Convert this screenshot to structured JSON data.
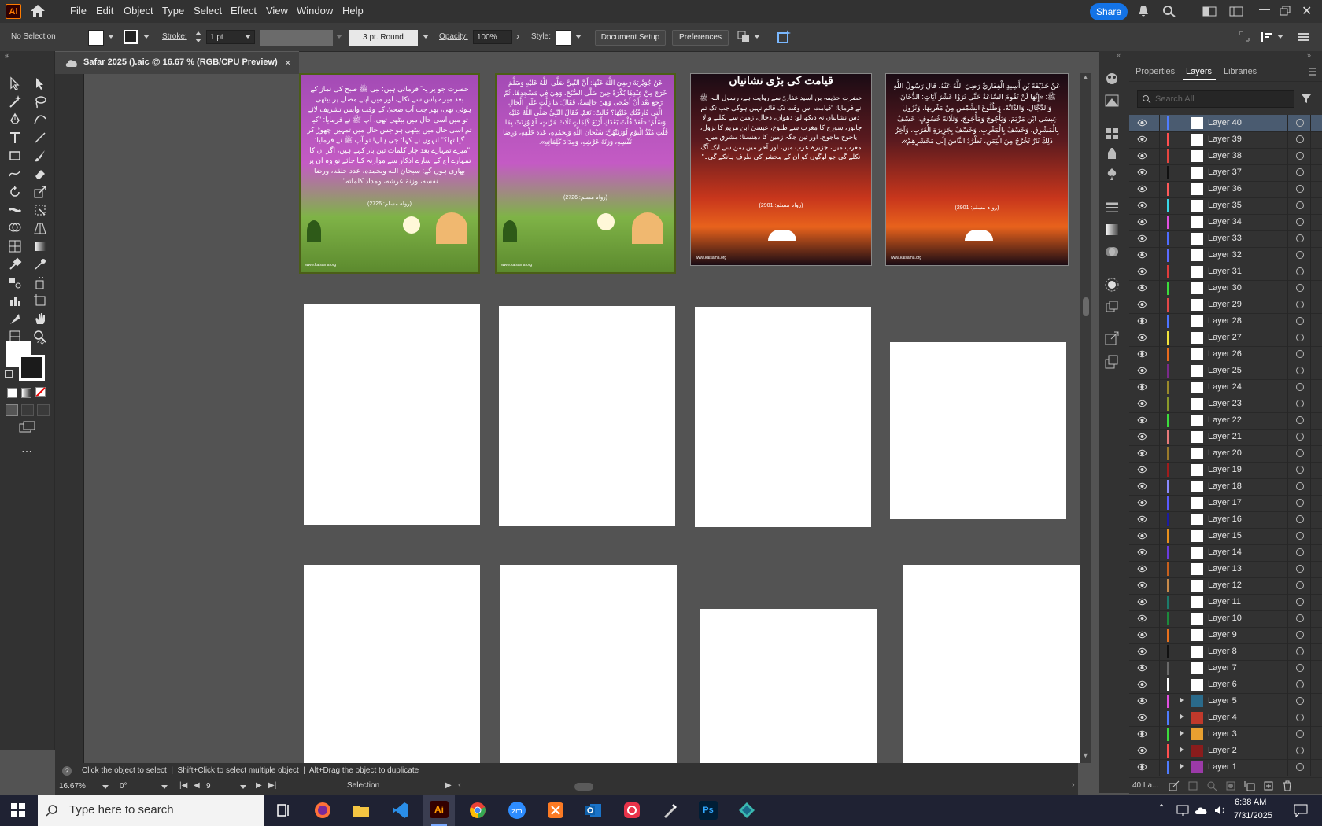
{
  "app": {
    "logo": "Ai",
    "share_label": "Share"
  },
  "menu": [
    "File",
    "Edit",
    "Object",
    "Type",
    "Select",
    "Effect",
    "View",
    "Window",
    "Help"
  ],
  "control_bar": {
    "selection_label": "No Selection",
    "stroke_label": "Stroke:",
    "stroke_value": "1 pt",
    "brush_value": "3 pt. Round",
    "opacity_label": "Opacity:",
    "opacity_value": "100%",
    "style_label": "Style:",
    "document_setup": "Document Setup",
    "preferences": "Preferences"
  },
  "document_tab": {
    "title": "Safar 2025 ().aic @ 16.67 % (RGB/CPU Preview)",
    "close": "×"
  },
  "artwork": {
    "poster1_text": "حضرت جو یر یہ ؓ فرماتی ہیں: نبی ﷺ صبح کی نماز کے بعد میرے پاس سے نکلے، اور میں اپنے مصلے پر بیٹھی ہوئی تھی، پھر جب آپ ضحیٰ کے وقت واپس تشریف لائے تو میں اسی حال میں بیٹھی تھی، آپ ﷺ نے فرمایا: \"کیا تم اسی حال میں بیٹھی ہو جس حال میں تمہیں چھوڑ کر گیا تھا؟\" انہوں نے کہا: جی ہاں! تو آپ ﷺ نے فرمایا: \"میرے تمہارے بعد چار کلمات تین بار کہے ہیں، اگر ان کا تمہارے آج کے سارے اذکار سے موازنہ کیا جائے تو وہ ان پر بھاری ہوں گے: سبحان الله وبحمده، عدد خلقه، ورضا نفسه، وزنة عرشه، ومداد كلماته\".",
    "poster1_ref": "(رواہ مسلم: 2726)",
    "poster2_text": "عَنْ جُوَيْرِيَةَ رَضِيَ اللَّهُ عَنْهَا: أَنَّ النَّبِيَّ صَلَّى اللَّهُ عَلَيْهِ وَسَلَّمَ خَرَجَ مِنْ عِنْدِهَا بُكْرَةً حِينَ صَلَّى الصُّبْحَ، وَهِيَ فِي مَسْجِدِهَا، ثُمَّ رَجَعَ بَعْدَ أَنْ أَضْحَى وَهِيَ جَالِسَةٌ، فَقَالَ: مَا زِلْتِ عَلَى الْحَالِ الَّتِي فَارَقْتُكِ عَلَيْهَا؟ قَالَتْ: نَعَمْ. فَقَالَ النَّبِيُّ صَلَّى اللَّهُ عَلَيْهِ وَسَلَّمَ: «لَقَدْ قُلْتُ بَعْدَكِ أَرْبَعَ كَلِمَاتٍ ثَلَاثَ مَرَّاتٍ، لَوْ وُزِنَتْ بِمَا قُلْتِ مُنْذُ الْيَوْمِ لَوَزَنَتْهُنَّ: سُبْحَانَ اللَّهِ وَبِحَمْدِهِ، عَدَدَ خَلْقِهِ، وَرِضَا نَفْسِهِ، وَزِنَةَ عَرْشِهِ، وَمِدَادَ كَلِمَاتِهِ».",
    "poster2_ref": "(رواہ مسلم: 2726)",
    "poster3_title": "قیامت کی بڑی نشانیاں",
    "poster3_text": "حضرت حذیفہ بن اَسید غفاریؓ سے روایت ہے، رسول اللہ ﷺ نے فرمایا: \"قیامت اس وقت تک قائم نہیں ہوگی جب تک تم دس نشانیاں نہ دیکھ لو: دھواں، دجال، زمین سے نکلنے والا جانور، سورج کا مغرب سے طلوع، عیسیٰ ابن مریم کا نزول، یاجوج ماجوج، اور تین جگہ زمین کا دھنسنا: مشرق میں، مغرب میں، جزیرہ عرب میں، اور آخر میں یمن سے ایک آگ نکلے گی جو لوگوں کو ان کے محشر کی طرف ہانکے گی۔\"",
    "poster3_ref": "(رواہ مسلم: 2901)",
    "poster4_text": "عَنْ حُذَيْفَةَ بْنِ أَسِيدٍ الْغِفَارِيِّ رَضِيَ اللَّهُ عَنْهُ، قَالَ رَسُولُ اللَّهِ ﷺ: «إِنَّهَا لَنْ تَقُومَ السَّاعَةُ حَتَّى تَرَوْا عَشْرَ آيَاتٍ: الدُّخَانَ، وَالدَّجَّالَ، وَالدَّابَّةَ، وَطُلُوعَ الشَّمْسِ مِنْ مَغْرِبِهَا، وَنُزُولَ عِيسَى ابْنِ مَرْيَمَ، وَيَأْجُوجَ وَمَأْجُوجَ، وَثَلَاثَةَ خُسُوفٍ: خَسْفٌ بِالْمَشْرِقِ، وَخَسْفٌ بِالْمَغْرِبِ، وَخَسْفٌ بِجَزِيرَةِ الْعَرَبِ، وَآخِرُ ذَلِكَ نَارٌ تَخْرُجُ مِنَ الْيَمَنِ، تَطْرُدُ النَّاسَ إِلَى مَحْشَرِهِمْ».",
    "poster4_ref": "(رواہ مسلم: 2901)",
    "website": "www.kalsama.org"
  },
  "status_hint": "Click the object to select  |  Shift+Click to select multiple object  |  Alt+Drag the object to duplicate",
  "status_bar": {
    "zoom": "16.67%",
    "rotation": "0°",
    "artboard": "9",
    "tool": "Selection"
  },
  "panel": {
    "tabs": [
      "Properties",
      "Layers",
      "Libraries"
    ],
    "search_placeholder": "Search All",
    "layer_count": "40 La...",
    "layers": [
      {
        "name": "Layer 40",
        "color": "#4f7cff",
        "selected": true
      },
      {
        "name": "Layer 39",
        "color": "#ff4f4f"
      },
      {
        "name": "Layer 38",
        "color": "#e5453f"
      },
      {
        "name": "Layer 37",
        "color": "#111111"
      },
      {
        "name": "Layer 36",
        "color": "#ff5a5a"
      },
      {
        "name": "Layer 35",
        "color": "#39d8e8"
      },
      {
        "name": "Layer 34",
        "color": "#e04fe0"
      },
      {
        "name": "Layer 33",
        "color": "#4f6cff"
      },
      {
        "name": "Layer 32",
        "color": "#5b6bff"
      },
      {
        "name": "Layer 31",
        "color": "#e03c3c"
      },
      {
        "name": "Layer 30",
        "color": "#3cdc3c"
      },
      {
        "name": "Layer 29",
        "color": "#e34848"
      },
      {
        "name": "Layer 28",
        "color": "#4d74ff"
      },
      {
        "name": "Layer 27",
        "color": "#f0e23c"
      },
      {
        "name": "Layer 26",
        "color": "#e86a1c"
      },
      {
        "name": "Layer 25",
        "color": "#7a2a8a"
      },
      {
        "name": "Layer 24",
        "color": "#9a8a2a"
      },
      {
        "name": "Layer 23",
        "color": "#8a9a2a"
      },
      {
        "name": "Layer 22",
        "color": "#3cdc3c"
      },
      {
        "name": "Layer 21",
        "color": "#e87a7a"
      },
      {
        "name": "Layer 20",
        "color": "#9a7a2a"
      },
      {
        "name": "Layer 19",
        "color": "#a01c1c"
      },
      {
        "name": "Layer 18",
        "color": "#8a8aff"
      },
      {
        "name": "Layer 17",
        "color": "#5a5aff"
      },
      {
        "name": "Layer 16",
        "color": "#1c1ca0"
      },
      {
        "name": "Layer 15",
        "color": "#e8901c"
      },
      {
        "name": "Layer 14",
        "color": "#6a3cdc"
      },
      {
        "name": "Layer 13",
        "color": "#c8601c"
      },
      {
        "name": "Layer 12",
        "color": "#c88a4a"
      },
      {
        "name": "Layer 11",
        "color": "#1c7a6a"
      },
      {
        "name": "Layer 10",
        "color": "#1c8a3c"
      },
      {
        "name": "Layer 9",
        "color": "#e8701c"
      },
      {
        "name": "Layer 8",
        "color": "#111111"
      },
      {
        "name": "Layer 7",
        "color": "#6a6a6a"
      },
      {
        "name": "Layer 6",
        "color": "#ffffff"
      },
      {
        "name": "Layer 5",
        "color": "#e04fe0",
        "expand": true,
        "thumb": "#2a6a8a"
      },
      {
        "name": "Layer 4",
        "color": "#4f7cff",
        "expand": true,
        "thumb": "#c0392b"
      },
      {
        "name": "Layer 3",
        "color": "#3cdc3c",
        "expand": true,
        "thumb": "#e8a030"
      },
      {
        "name": "Layer 2",
        "color": "#ff4f4f",
        "expand": true,
        "thumb": "#8a1c1c"
      },
      {
        "name": "Layer 1",
        "color": "#4f7cff",
        "expand": true,
        "thumb": "#9b3aa8"
      }
    ]
  },
  "taskbar": {
    "search_placeholder": "Type here to search",
    "time": "6:38 AM",
    "date": "7/31/2025"
  }
}
